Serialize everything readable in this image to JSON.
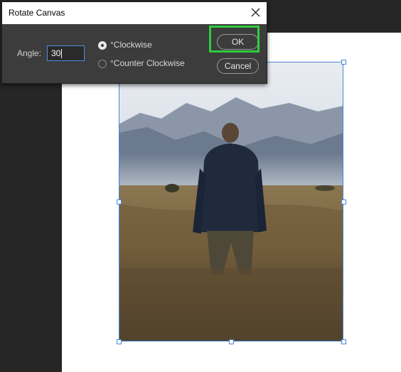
{
  "dialog": {
    "title": "Rotate Canvas",
    "angle_label": "Angle:",
    "angle_value": "30",
    "options": [
      {
        "label": "°Clockwise",
        "selected": true
      },
      {
        "label": "°Counter Clockwise",
        "selected": false
      }
    ],
    "ok_label": "OK",
    "cancel_label": "Cancel"
  },
  "colors": {
    "workspace": "#262626",
    "dialog_bg": "#3c3c3c",
    "highlight": "#2ecc3f",
    "selection": "#4a86d8"
  },
  "icons": {
    "close": "close-icon"
  }
}
